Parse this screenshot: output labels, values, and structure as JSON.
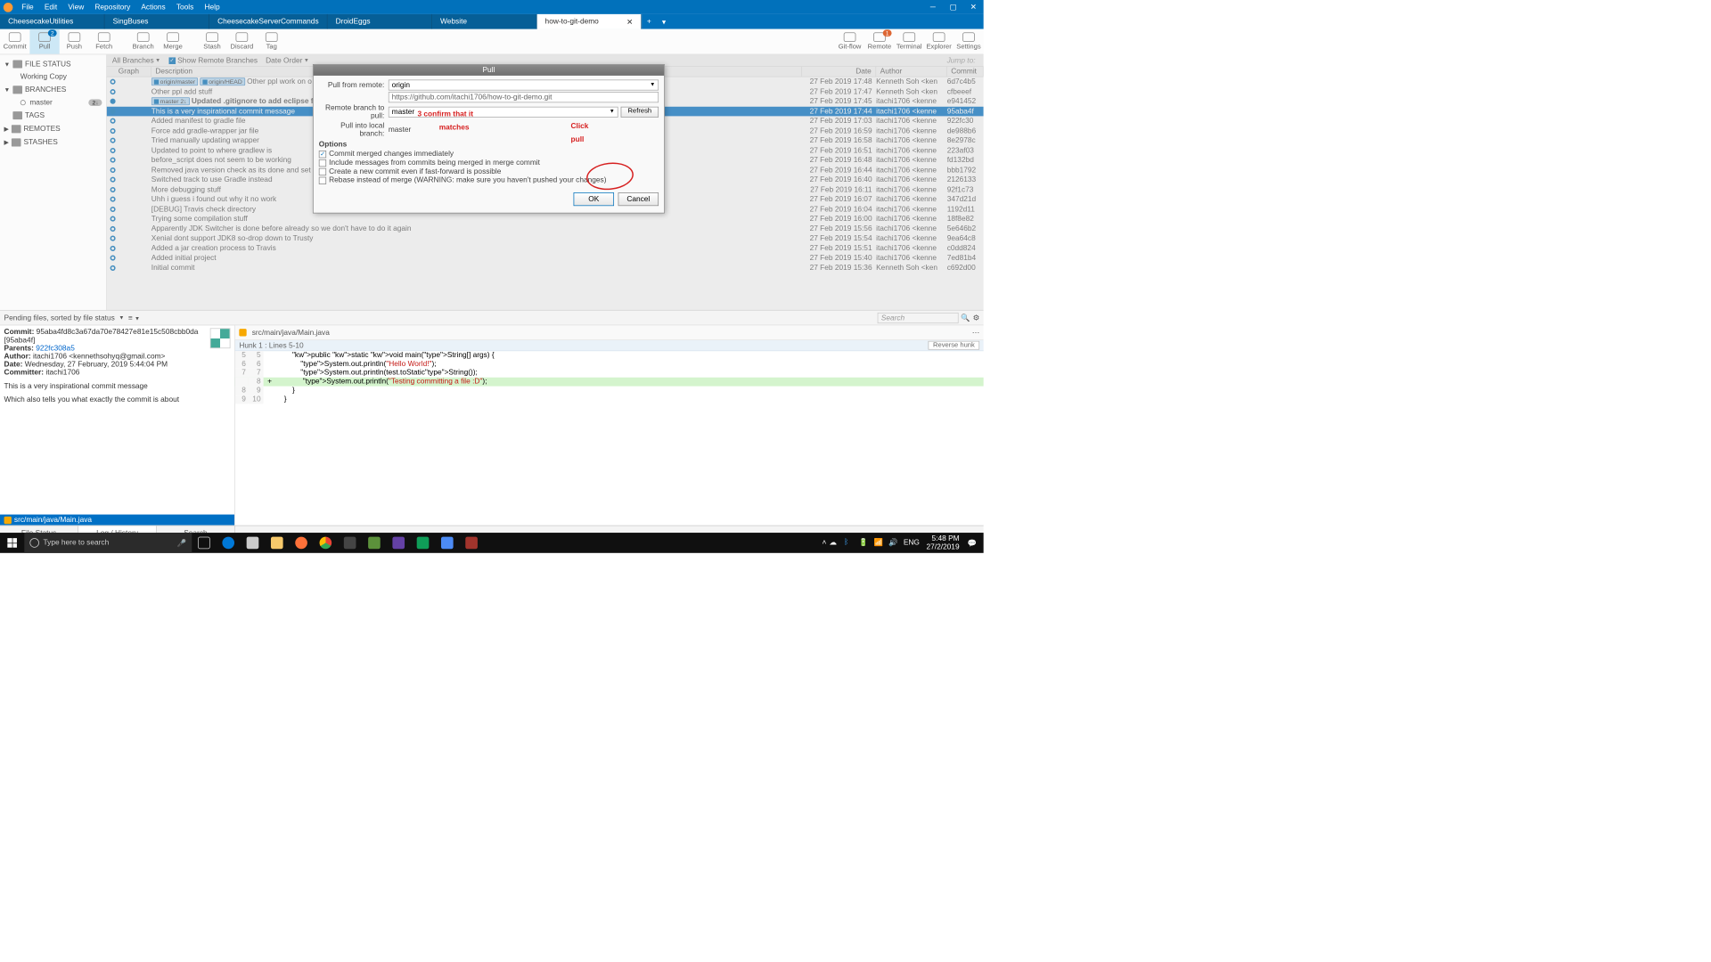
{
  "menus": [
    "File",
    "Edit",
    "View",
    "Repository",
    "Actions",
    "Tools",
    "Help"
  ],
  "tabs": [
    {
      "label": "CheesecakeUtilities"
    },
    {
      "label": "SingBuses"
    },
    {
      "label": "CheesecakeServerCommands"
    },
    {
      "label": "DroidEggs"
    },
    {
      "label": "Website"
    },
    {
      "label": "how-to-git-demo",
      "active": true
    }
  ],
  "toolbar": {
    "commit": "Commit",
    "pull": "Pull",
    "push": "Push",
    "fetch": "Fetch",
    "branch": "Branch",
    "merge": "Merge",
    "stash": "Stash",
    "discard": "Discard",
    "tag": "Tag",
    "gitflow": "Git-flow",
    "remote": "Remote",
    "terminal": "Terminal",
    "explorer": "Explorer",
    "settings": "Settings",
    "pull_badge": "2",
    "remote_badge": "1"
  },
  "sidebar": {
    "file_status": "FILE STATUS",
    "working_copy": "Working Copy",
    "branches": "BRANCHES",
    "master": "master",
    "master_badge": "2↓",
    "tags": "TAGS",
    "remotes": "REMOTES",
    "stashes": "STASHES"
  },
  "filters": {
    "all_branches": "All Branches",
    "show_remote": "Show Remote Branches",
    "date_order": "Date Order",
    "jump": "Jump to:"
  },
  "headers": {
    "graph": "Graph",
    "desc": "Description",
    "date": "Date",
    "author": "Author",
    "commit": "Commit"
  },
  "commits": [
    {
      "refs": [
        "origin/master",
        "origin/HEAD"
      ],
      "msg": "Other ppl work on o",
      "date": "27 Feb 2019 17:48",
      "author": "Kenneth Soh <ken",
      "hash": "6d7c4b5"
    },
    {
      "refs": [],
      "msg": "Other ppl add stuff",
      "date": "27 Feb 2019 17:47",
      "author": "Kenneth Soh <ken",
      "hash": "cfbeeef"
    },
    {
      "refs": [
        "master 2↓"
      ],
      "msg": "Updated .gitignore to add eclipse files",
      "date": "27 Feb 2019 17:45",
      "author": "itachi1706 <kenne",
      "hash": "e941452",
      "bold": true
    },
    {
      "refs": [],
      "msg": "This is a very inspirational commit message",
      "date": "27 Feb 2019 17:44",
      "author": "itachi1706 <kenne",
      "hash": "95aba4f",
      "sel": true
    },
    {
      "refs": [],
      "msg": "Added manifest to gradle file",
      "date": "27 Feb 2019 17:03",
      "author": "itachi1706 <kenne",
      "hash": "922fc30"
    },
    {
      "refs": [],
      "msg": "Force add gradle-wrapper jar file",
      "date": "27 Feb 2019 16:59",
      "author": "itachi1706 <kenne",
      "hash": "de988b6"
    },
    {
      "refs": [],
      "msg": "Tried manually updating wrapper",
      "date": "27 Feb 2019 16:58",
      "author": "itachi1706 <kenne",
      "hash": "8e2978c"
    },
    {
      "refs": [],
      "msg": "Updated to point to where gradlew is",
      "date": "27 Feb 2019 16:51",
      "author": "itachi1706 <kenne",
      "hash": "223af03"
    },
    {
      "refs": [],
      "msg": "before_script does not seem to be working",
      "date": "27 Feb 2019 16:48",
      "author": "itachi1706 <kenne",
      "hash": "fd132bd"
    },
    {
      "refs": [],
      "msg": "Removed java version check as its done and set gradle to ex",
      "date": "27 Feb 2019 16:44",
      "author": "itachi1706 <kenne",
      "hash": "bbb1792"
    },
    {
      "refs": [],
      "msg": "Switched track to use Gradle instead",
      "date": "27 Feb 2019 16:40",
      "author": "itachi1706 <kenne",
      "hash": "2126133"
    },
    {
      "refs": [],
      "msg": "More debugging stuff",
      "date": "27 Feb 2019 16:11",
      "author": "itachi1706 <kenne",
      "hash": "92f1c73"
    },
    {
      "refs": [],
      "msg": "Uhh i guess i found out why it no work",
      "date": "27 Feb 2019 16:07",
      "author": "itachi1706 <kenne",
      "hash": "347d21d"
    },
    {
      "refs": [],
      "msg": "[DEBUG] Travis check directory",
      "date": "27 Feb 2019 16:04",
      "author": "itachi1706 <kenne",
      "hash": "1192d11"
    },
    {
      "refs": [],
      "msg": "Trying some compilation stuff",
      "date": "27 Feb 2019 16:00",
      "author": "itachi1706 <kenne",
      "hash": "18f8e82"
    },
    {
      "refs": [],
      "msg": "Apparently JDK Switcher is done before already so we don't have to do it again",
      "date": "27 Feb 2019 15:56",
      "author": "itachi1706 <kenne",
      "hash": "5e646b2"
    },
    {
      "refs": [],
      "msg": "Xenial dont support JDK8 so-drop down to Trusty",
      "date": "27 Feb 2019 15:54",
      "author": "itachi1706 <kenne",
      "hash": "9ea64c8"
    },
    {
      "refs": [],
      "msg": "Added a jar creation process to Travis",
      "date": "27 Feb 2019 15:51",
      "author": "itachi1706 <kenne",
      "hash": "c0dd824"
    },
    {
      "refs": [],
      "msg": "Added initial project",
      "date": "27 Feb 2019 15:40",
      "author": "itachi1706 <kenne",
      "hash": "7ed81b4"
    },
    {
      "refs": [],
      "msg": "Initial commit",
      "date": "27 Feb 2019 15:36",
      "author": "Kenneth Soh <ken",
      "hash": "c692d00"
    }
  ],
  "detail": {
    "pending": "Pending files, sorted by file status",
    "commit_label": "Commit:",
    "commit_val": "95aba4fd8c3a67da70e78427e81e15c508cbb0da [95aba4f]",
    "parents_label": "Parents:",
    "parents_val": "922fc308a5",
    "author_label": "Author:",
    "author_val": "itachi1706 <kennethsohyq@gmail.com>",
    "date_label": "Date:",
    "date_val": "Wednesday, 27 February, 2019 5:44:04 PM",
    "committer_label": "Committer:",
    "committer_val": "itachi1706",
    "msg1": "This is a very inspirational commit message",
    "msg2": "Which also tells you what exactly the commit is about",
    "file": "src/main/java/Main.java",
    "search": "Search"
  },
  "diff": {
    "file": "src/main/java/Main.java",
    "hunk": "Hunk 1 : Lines 5-10",
    "reverse": "Reverse hunk",
    "lines": [
      {
        "a": "5",
        "b": "5",
        "t": "        public static void main(String[] args) {"
      },
      {
        "a": "6",
        "b": "6",
        "t": "            System.out.println(\"Hello World!\");"
      },
      {
        "a": "7",
        "b": "7",
        "t": "            System.out.println(test.toStaticString());"
      },
      {
        "a": "",
        "b": "8",
        "t": "            System.out.println(\"Testing committing a file :D\");",
        "add": true
      },
      {
        "a": "8",
        "b": "9",
        "t": "        }"
      },
      {
        "a": "9",
        "b": "10",
        "t": "    }"
      }
    ]
  },
  "btabs": {
    "file_status": "File Status",
    "log": "Log / History",
    "search": "Search"
  },
  "dialog": {
    "title": "Pull",
    "pull_from": "Pull from remote:",
    "remote": "origin",
    "url": "https://github.com/itachi1706/how-to-git-demo.git",
    "remote_branch_label": "Remote branch to pull:",
    "remote_branch": "master",
    "refresh": "Refresh",
    "local_branch_label": "Pull into local branch:",
    "local_branch": "master",
    "options": "Options",
    "opt1": "Commit merged changes immediately",
    "opt2": "Include messages from commits being merged in merge commit",
    "opt3": "Create a new commit even if fast-forward is possible",
    "opt4": "Rebase instead of merge (WARNING: make sure you haven't pushed your changes)",
    "ok": "OK",
    "cancel": "Cancel"
  },
  "annot": {
    "step3": "3 confirm that it",
    "step3b": "matches",
    "click": "Click",
    "pull": "pull"
  },
  "taskbar": {
    "search": "Type here to search",
    "time": "5:48 PM",
    "date": "27/2/2019",
    "lang": "ENG"
  }
}
